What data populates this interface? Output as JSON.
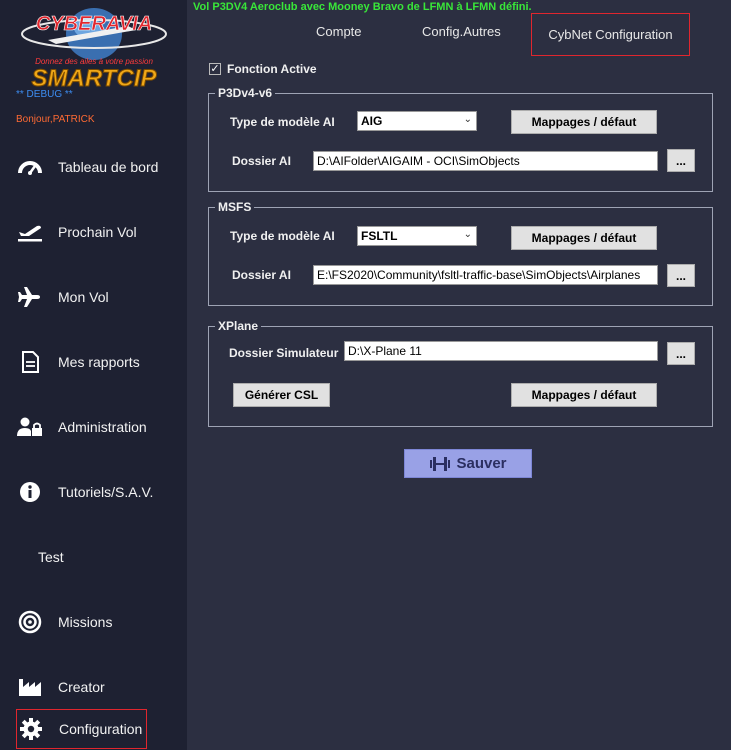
{
  "sidebar": {
    "logo_top": "CYBERAVIA",
    "logo_tagline": "Donnez des ailes à votre passion",
    "logo_bottom": "SMARTCIP",
    "debug": "** DEBUG **",
    "greeting": "Bonjour,PATRICK",
    "items": [
      {
        "label": "Tableau de bord",
        "icon": "dashboard-icon"
      },
      {
        "label": "Prochain Vol",
        "icon": "plane-departure-icon"
      },
      {
        "label": "Mon Vol",
        "icon": "plane-icon"
      },
      {
        "label": "Mes rapports",
        "icon": "report-icon"
      },
      {
        "label": "Administration",
        "icon": "user-lock-icon"
      },
      {
        "label": "Tutoriels/S.A.V.",
        "icon": "info-icon"
      },
      {
        "label": "Test",
        "icon": ""
      },
      {
        "label": "Missions",
        "icon": "target-icon"
      },
      {
        "label": "Creator",
        "icon": "industry-icon"
      },
      {
        "label": "Configuration",
        "icon": "gear-icon"
      }
    ]
  },
  "banner": "Vol P3DV4 Aeroclub avec Mooney Bravo de LFMN à LFMN défini.",
  "tabs": [
    "Compte",
    "Config.Autres",
    "CybNet Configuration"
  ],
  "fonction_active": {
    "label": "Fonction Active",
    "checked": true
  },
  "p3d": {
    "title": "P3Dv4-v6",
    "type_label": "Type de modèle AI",
    "type_value": "AIG",
    "mapping_button": "Mappages / défaut",
    "folder_label": "Dossier AI",
    "folder_value": "D:\\AIFolder\\AIGAIM - OCI\\SimObjects",
    "browse": "..."
  },
  "msfs": {
    "title": "MSFS",
    "type_label": "Type de modèle AI",
    "type_value": "FSLTL",
    "mapping_button": "Mappages / défaut",
    "folder_label": "Dossier AI",
    "folder_value": "E:\\FS2020\\Community\\fsltl-traffic-base\\SimObjects\\Airplanes",
    "browse": "..."
  },
  "xplane": {
    "title": "XPlane",
    "folder_label": "Dossier Simulateur",
    "folder_value": "D:\\X-Plane 11",
    "browse": "...",
    "csl_button": "Générer CSL",
    "mapping_button": "Mappages / défaut"
  },
  "save_button": "Sauver",
  "colors": {
    "accent": "#e0262e",
    "banner": "#39e639",
    "save": "#99a1e6"
  }
}
